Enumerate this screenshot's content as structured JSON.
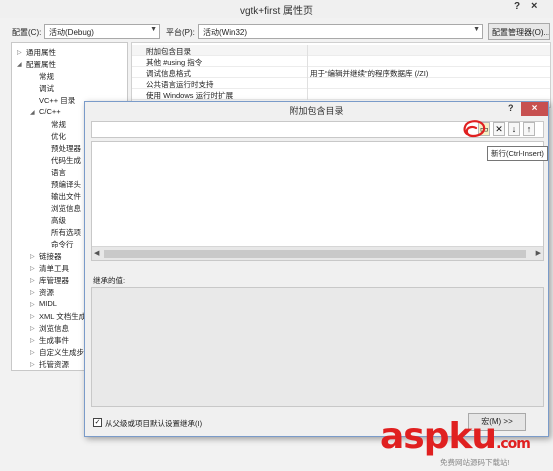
{
  "window": {
    "title": "vgtk+first 属性页",
    "help_glyph": "?",
    "close_glyph": "×"
  },
  "toolbar": {
    "config_label": "配置(C):",
    "config_value": "活动(Debug)",
    "platform_label": "平台(P):",
    "platform_value": "活动(Win32)",
    "config_manager_label": "配置管理器(O)..."
  },
  "tree": {
    "items": [
      "通用属性",
      "配置属性",
      "常规",
      "调试",
      "VC++ 目录",
      "C/C++",
      "常规",
      "优化",
      "预处理器",
      "代码生成",
      "语言",
      "预编译头",
      "输出文件",
      "浏览信息",
      "高级",
      "所有选项",
      "命令行",
      "链接器",
      "清单工具",
      "库管理器",
      "资源",
      "MIDL",
      "XML 文档生成",
      "浏览信息",
      "生成事件",
      "自定义生成步",
      "托管资源"
    ]
  },
  "grid": {
    "rows": [
      {
        "name": "附加包含目录",
        "value": ""
      },
      {
        "name": "其他 #using 指令",
        "value": ""
      },
      {
        "name": "调试信息格式",
        "value": "用于“编辑并继续”的程序数据库 (/ZI)"
      },
      {
        "name": "公共语言运行时支持",
        "value": ""
      },
      {
        "name": "使用 Windows 运行时扩展",
        "value": ""
      }
    ]
  },
  "dialog": {
    "title": "附加包含目录",
    "help_glyph": "?",
    "close_glyph": "×",
    "tooltip": "新行(Ctrl-Insert)",
    "new_line_glyph": "▭",
    "delete_glyph": "✕",
    "down_glyph": "↓",
    "up_glyph": "↑",
    "inherited_label": "继承的值:",
    "inherit_checkbox_label": "从父级或项目默认设置继承(I)",
    "inherit_checked": "✓",
    "macros_button": "宏(M) >>"
  },
  "watermark": {
    "logo": "aspku",
    "logo_tail": ".com",
    "subtitle": "免费网站源码下载站!"
  },
  "colors": {
    "close_red": "#c75050",
    "watermark_red": "#e02020",
    "dialog_border": "#7a9bc9"
  }
}
